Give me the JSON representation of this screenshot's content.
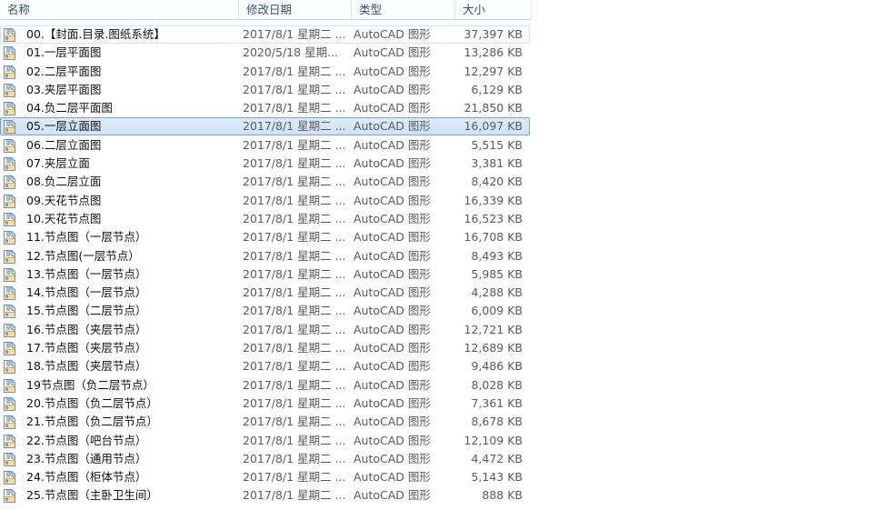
{
  "window": {
    "app": "file-explorer",
    "view_mode": "details"
  },
  "columns": [
    {
      "key": "name",
      "label": "名称"
    },
    {
      "key": "date",
      "label": "修改日期"
    },
    {
      "key": "type",
      "label": "类型"
    },
    {
      "key": "size",
      "label": "大小"
    }
  ],
  "colors": {
    "header_text": "#34506b",
    "header_rule": "#b8d6e8",
    "selection_fill": "#d5e6f9",
    "selection_border": "#7da2ce",
    "focus_border": "#cfe4f5",
    "secondary_text": "#5a5a5a",
    "icon_page": "#ffffff",
    "icon_fold": "#f0b74a",
    "icon_accent": "#3a7bbf"
  },
  "icons": {
    "file_icon_name": "autocad-drawing-icon"
  },
  "rows": [
    {
      "icon": "autocad-drawing-icon",
      "name": "00.【封面.目录.图纸系统】",
      "date": "2017/8/1 星期二 ...",
      "type": "AutoCAD 图形",
      "size": "37,397 KB",
      "state": "focused"
    },
    {
      "icon": "autocad-drawing-icon",
      "name": "01.一层平面图",
      "date": "2020/5/18 星期...",
      "type": "AutoCAD 图形",
      "size": "13,286 KB",
      "state": "normal"
    },
    {
      "icon": "autocad-drawing-icon",
      "name": "02.二层平面图",
      "date": "2017/8/1 星期二 ...",
      "type": "AutoCAD 图形",
      "size": "12,297 KB",
      "state": "normal"
    },
    {
      "icon": "autocad-drawing-icon",
      "name": "03.夹层平面图",
      "date": "2017/8/1 星期二 ...",
      "type": "AutoCAD 图形",
      "size": "6,129 KB",
      "state": "normal"
    },
    {
      "icon": "autocad-drawing-icon",
      "name": "04.负二层平面图",
      "date": "2017/8/1 星期二 ...",
      "type": "AutoCAD 图形",
      "size": "21,850 KB",
      "state": "normal"
    },
    {
      "icon": "autocad-drawing-icon",
      "name": "05.一层立面图",
      "date": "2017/8/1 星期二 ...",
      "type": "AutoCAD 图形",
      "size": "16,097 KB",
      "state": "selected"
    },
    {
      "icon": "autocad-drawing-icon",
      "name": "06.二层立面图",
      "date": "2017/8/1 星期二 ...",
      "type": "AutoCAD 图形",
      "size": "5,515 KB",
      "state": "normal"
    },
    {
      "icon": "autocad-drawing-icon",
      "name": "07.夹层立面",
      "date": "2017/8/1 星期二 ...",
      "type": "AutoCAD 图形",
      "size": "3,381 KB",
      "state": "normal"
    },
    {
      "icon": "autocad-drawing-icon",
      "name": "08.负二层立面",
      "date": "2017/8/1 星期二 ...",
      "type": "AutoCAD 图形",
      "size": "8,420 KB",
      "state": "normal"
    },
    {
      "icon": "autocad-drawing-icon",
      "name": "09.天花节点图",
      "date": "2017/8/1 星期二 ...",
      "type": "AutoCAD 图形",
      "size": "16,339 KB",
      "state": "normal"
    },
    {
      "icon": "autocad-drawing-icon",
      "name": "10.天花节点图",
      "date": "2017/8/1 星期二 ...",
      "type": "AutoCAD 图形",
      "size": "16,523 KB",
      "state": "normal"
    },
    {
      "icon": "autocad-drawing-icon",
      "name": "11.节点图（一层节点）",
      "date": "2017/8/1 星期二 ...",
      "type": "AutoCAD 图形",
      "size": "16,708 KB",
      "state": "normal"
    },
    {
      "icon": "autocad-drawing-icon",
      "name": "12.节点图(一层节点）",
      "date": "2017/8/1 星期二 ...",
      "type": "AutoCAD 图形",
      "size": "8,493 KB",
      "state": "normal"
    },
    {
      "icon": "autocad-drawing-icon",
      "name": "13.节点图（一层节点）",
      "date": "2017/8/1 星期二 ...",
      "type": "AutoCAD 图形",
      "size": "5,985 KB",
      "state": "normal"
    },
    {
      "icon": "autocad-drawing-icon",
      "name": "14.节点图（一层节点）",
      "date": "2017/8/1 星期二 ...",
      "type": "AutoCAD 图形",
      "size": "4,288 KB",
      "state": "normal"
    },
    {
      "icon": "autocad-drawing-icon",
      "name": "15.节点图（二层节点）",
      "date": "2017/8/1 星期二 ...",
      "type": "AutoCAD 图形",
      "size": "6,009 KB",
      "state": "normal"
    },
    {
      "icon": "autocad-drawing-icon",
      "name": "16.节点图（夹层节点）",
      "date": "2017/8/1 星期二 ...",
      "type": "AutoCAD 图形",
      "size": "12,721 KB",
      "state": "normal"
    },
    {
      "icon": "autocad-drawing-icon",
      "name": "17.节点图（夹层节点）",
      "date": "2017/8/1 星期二 ...",
      "type": "AutoCAD 图形",
      "size": "12,689 KB",
      "state": "normal"
    },
    {
      "icon": "autocad-drawing-icon",
      "name": "18.节点图（夹层节点）",
      "date": "2017/8/1 星期二 ...",
      "type": "AutoCAD 图形",
      "size": "9,486 KB",
      "state": "normal"
    },
    {
      "icon": "autocad-drawing-icon",
      "name": "19节点图（负二层节点）",
      "date": "2017/8/1 星期二 ...",
      "type": "AutoCAD 图形",
      "size": "8,028 KB",
      "state": "normal"
    },
    {
      "icon": "autocad-drawing-icon",
      "name": "20.节点图（负二层节点）",
      "date": "2017/8/1 星期二 ...",
      "type": "AutoCAD 图形",
      "size": "7,361 KB",
      "state": "normal"
    },
    {
      "icon": "autocad-drawing-icon",
      "name": "21.节点图（负二层节点）",
      "date": "2017/8/1 星期二 ...",
      "type": "AutoCAD 图形",
      "size": "8,678 KB",
      "state": "normal"
    },
    {
      "icon": "autocad-drawing-icon",
      "name": "22.节点图（吧台节点）",
      "date": "2017/8/1 星期二 ...",
      "type": "AutoCAD 图形",
      "size": "12,109 KB",
      "state": "normal"
    },
    {
      "icon": "autocad-drawing-icon",
      "name": "23.节点图（通用节点）",
      "date": "2017/8/1 星期二 ...",
      "type": "AutoCAD 图形",
      "size": "4,472 KB",
      "state": "normal"
    },
    {
      "icon": "autocad-drawing-icon",
      "name": "24.节点图（柜体节点）",
      "date": "2017/8/1 星期二 ...",
      "type": "AutoCAD 图形",
      "size": "5,143 KB",
      "state": "normal"
    },
    {
      "icon": "autocad-drawing-icon",
      "name": "25.节点图（主卧卫生间）",
      "date": "2017/8/1 星期二 ...",
      "type": "AutoCAD 图形",
      "size": "888 KB",
      "state": "normal"
    }
  ]
}
